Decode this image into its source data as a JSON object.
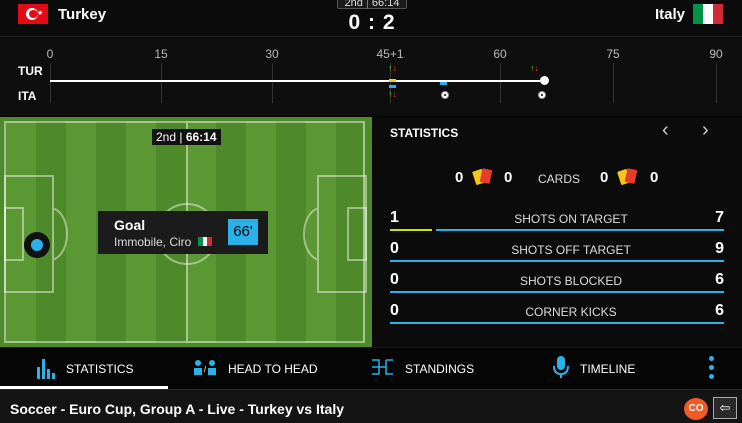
{
  "header": {
    "home_team": "Turkey",
    "away_team": "Italy",
    "period": "2nd",
    "clock": "66:14",
    "score": "0 : 2"
  },
  "timeline": {
    "home_code": "TUR",
    "away_code": "ITA",
    "ticks": [
      "0",
      "15",
      "30",
      "45+1",
      "60",
      "75",
      "90"
    ],
    "progress_minute": 66
  },
  "pitch": {
    "period": "2nd",
    "clock": "66:14",
    "event": {
      "type": "Goal",
      "player": "Immobile, Ciro",
      "minute": "66'"
    }
  },
  "statistics": {
    "title": "STATISTICS",
    "cards": {
      "label": "CARDS",
      "home_yellow": "0",
      "home_red": "0",
      "away_yellow": "0",
      "away_red": "0"
    },
    "rows": [
      {
        "label": "SHOTS ON TARGET",
        "home": "1",
        "away": "7",
        "home_share": 0.125
      },
      {
        "label": "SHOTS OFF TARGET",
        "home": "0",
        "away": "9",
        "home_share": 0
      },
      {
        "label": "SHOTS BLOCKED",
        "home": "0",
        "away": "6",
        "home_share": 0
      },
      {
        "label": "CORNER KICKS",
        "home": "0",
        "away": "6",
        "home_share": 0
      }
    ]
  },
  "nav": {
    "statistics": "STATISTICS",
    "head_to_head": "HEAD TO HEAD",
    "standings": "STANDINGS",
    "timeline": "TIMELINE"
  },
  "footer": {
    "title": "Soccer - Euro Cup, Group A - Live - Turkey vs Italy",
    "badge": "CO"
  },
  "colors": {
    "accent": "#2ab2e8",
    "home_bar": "#c8e600",
    "badge": "#f15a24"
  }
}
